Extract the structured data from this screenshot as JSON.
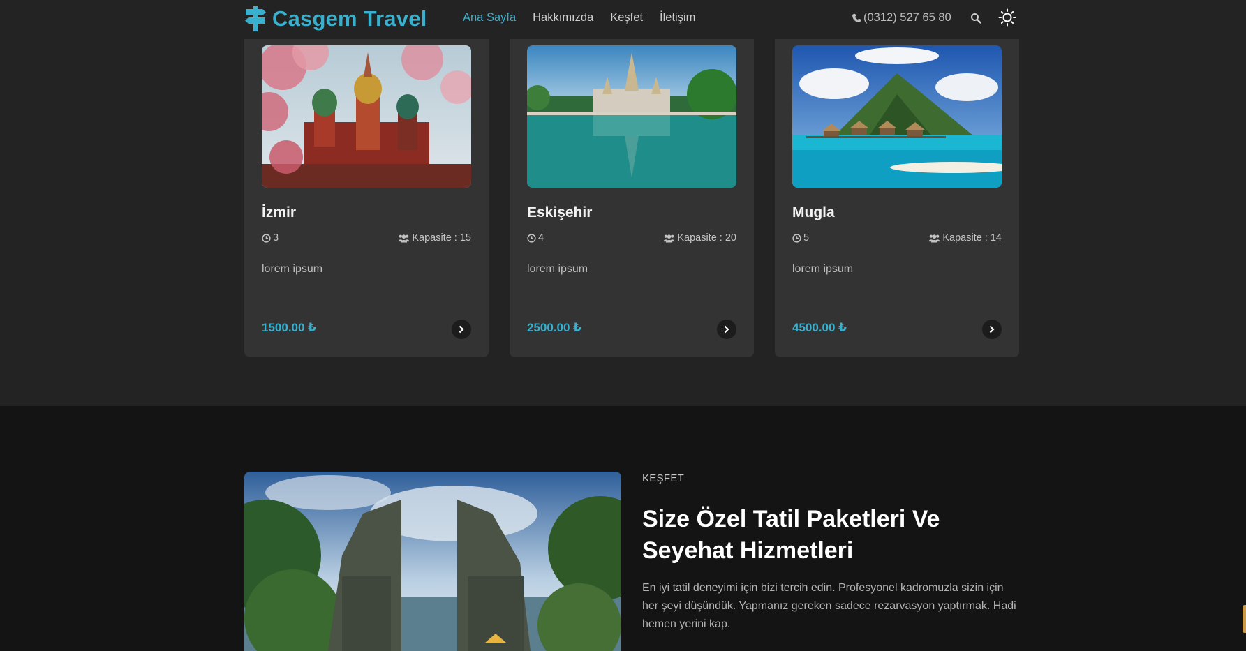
{
  "brand": {
    "name": "Casgem Travel",
    "accent": "#3ab0cf"
  },
  "nav": {
    "items": [
      {
        "label": "Ana Sayfa",
        "active": true
      },
      {
        "label": "Hakkımızda",
        "active": false
      },
      {
        "label": "Keşfet",
        "active": false
      },
      {
        "label": "İletişim",
        "active": false
      }
    ]
  },
  "header": {
    "phone": "(0312) 527 65 80"
  },
  "icons": {
    "logo": "signpost-icon",
    "phone": "phone-icon",
    "search": "search-icon",
    "theme": "sun-icon",
    "days": "clock-icon",
    "capacity": "users-icon",
    "arrow": "chevron-right-icon"
  },
  "cards": [
    {
      "title": "İzmir",
      "days": "3",
      "capacity": "Kapasite : 15",
      "desc": "lorem ipsum",
      "price": "1500.00 ₺"
    },
    {
      "title": "Eskişehir",
      "days": "4",
      "capacity": "Kapasite : 20",
      "desc": "lorem ipsum",
      "price": "2500.00 ₺"
    },
    {
      "title": "Mugla",
      "days": "5",
      "capacity": "Kapasite : 14",
      "desc": "lorem ipsum",
      "price": "4500.00 ₺"
    }
  ],
  "explore": {
    "kicker": "KEŞFET",
    "headline": "Size Özel Tatil Paketleri Ve Seyehat Hizmetleri",
    "paragraph": "En iyi tatil deneyimi için bizi tercih edin. Profesyonel kadromuzla sizin için her şeyi düşündük. Yapmanız gereken sadece rezarvasyon yaptırmak. Hadi hemen yerini kap."
  }
}
